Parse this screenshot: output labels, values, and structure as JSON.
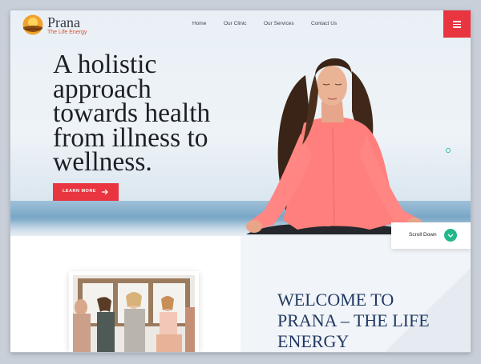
{
  "brand": {
    "name": "Prana",
    "tagline": "The Life Energy"
  },
  "nav": {
    "items": [
      {
        "label": "Home"
      },
      {
        "label": "Our Clinic"
      },
      {
        "label": "Our Services"
      },
      {
        "label": "Contact Us"
      }
    ],
    "menu_icon": "hamburger-icon"
  },
  "hero": {
    "headline_lines": [
      "A holistic",
      "approach",
      "towards health",
      "from illness to",
      "wellness."
    ],
    "cta_label": "LEARN MORE",
    "cta_icon": "arrow-right-icon"
  },
  "scroll": {
    "label": "Scroll Down",
    "icon": "chevron-down-icon"
  },
  "welcome": {
    "title_lines": [
      "WELCOME TO",
      "PRANA – THE LIFE",
      "ENERGY"
    ]
  },
  "colors": {
    "accent_red": "#e8353f",
    "accent_green": "#21b88c",
    "navy": "#213a62",
    "logo_orange": "#d9522f"
  }
}
